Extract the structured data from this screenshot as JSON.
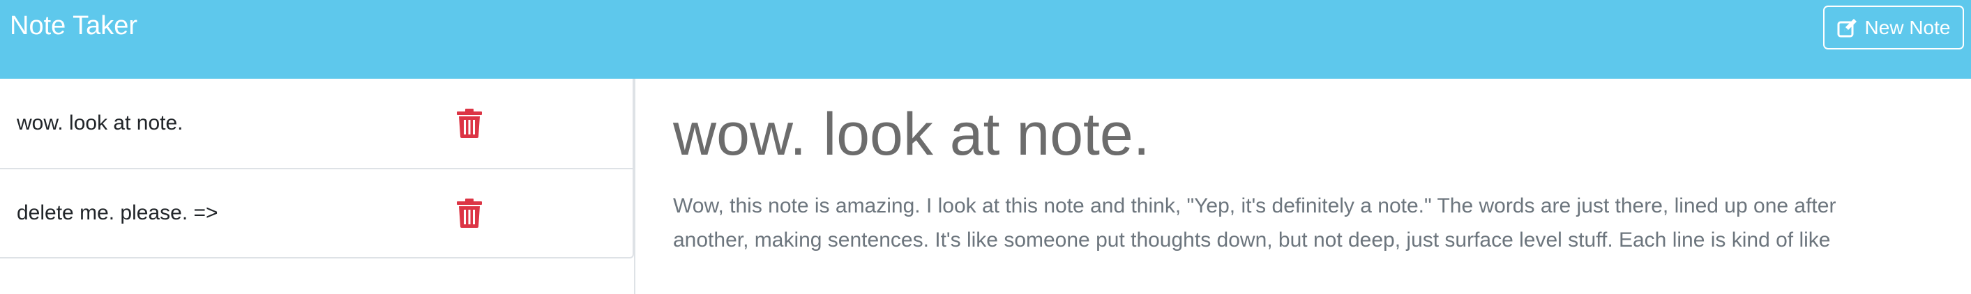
{
  "navbar": {
    "brand": "Note Taker",
    "new_note_label": "New Note",
    "new_note_icon": "edit-icon",
    "background_color": "#5ec8ec"
  },
  "sidebar": {
    "notes": [
      {
        "title": "wow. look at note.",
        "delete_icon": "trash-icon"
      },
      {
        "title": "delete me. please. =>",
        "delete_icon": "trash-icon"
      }
    ],
    "delete_icon_color": "#dc3545"
  },
  "main": {
    "title": "wow. look at note.",
    "body_lines": [
      "Wow, this note is amazing. I look at this note and think, \"Yep, it's definitely a note.\" The words are just there, lined up one after",
      "another, making sentences. It's like someone put thoughts down, but not deep, just surface level stuff. Each line is kind of like"
    ]
  }
}
